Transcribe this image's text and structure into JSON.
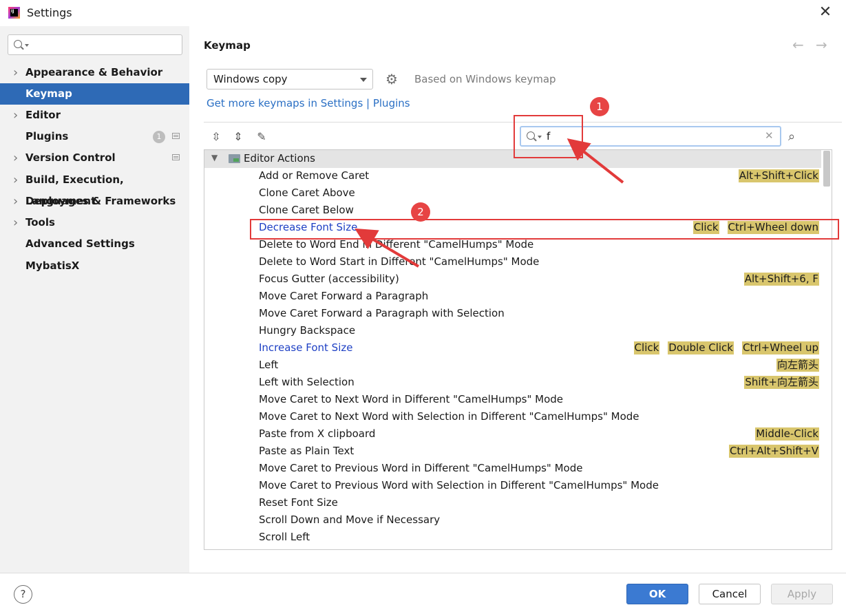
{
  "window": {
    "title": "Settings",
    "close_icon": "close-icon"
  },
  "sidebar": {
    "search_placeholder": "",
    "items": [
      {
        "label": "Appearance & Behavior",
        "expandable": true
      },
      {
        "label": "Keymap",
        "expandable": false,
        "selected": true
      },
      {
        "label": "Editor",
        "expandable": true
      },
      {
        "label": "Plugins",
        "expandable": false,
        "badge": "1"
      },
      {
        "label": "Version Control",
        "expandable": true
      },
      {
        "label": "Build, Execution, Deployment",
        "expandable": true
      },
      {
        "label": "Languages & Frameworks",
        "expandable": true
      },
      {
        "label": "Tools",
        "expandable": true
      },
      {
        "label": "Advanced Settings",
        "expandable": false
      },
      {
        "label": "MybatisX",
        "expandable": false
      }
    ]
  },
  "main": {
    "title": "Keymap",
    "keymap_select": "Windows copy",
    "based_on": "Based on Windows keymap",
    "get_more_link": "Get more keymaps in Settings | Plugins",
    "filter_value": "f",
    "group_label": "Editor Actions",
    "actions": [
      {
        "name": "Add or Remove Caret",
        "shortcuts": [
          "Alt+Shift+Click"
        ],
        "modified": false
      },
      {
        "name": "Clone Caret Above",
        "shortcuts": [],
        "modified": false
      },
      {
        "name": "Clone Caret Below",
        "shortcuts": [],
        "modified": false
      },
      {
        "name": "Decrease Font Size",
        "shortcuts": [
          "Click",
          "Ctrl+Wheel down"
        ],
        "modified": true
      },
      {
        "name": "Delete to Word End in Different \"CamelHumps\" Mode",
        "shortcuts": [],
        "modified": false
      },
      {
        "name": "Delete to Word Start in Different \"CamelHumps\" Mode",
        "shortcuts": [],
        "modified": false
      },
      {
        "name": "Focus Gutter (accessibility)",
        "shortcuts": [
          "Alt+Shift+6, F"
        ],
        "modified": false
      },
      {
        "name": "Move Caret Forward a Paragraph",
        "shortcuts": [],
        "modified": false
      },
      {
        "name": "Move Caret Forward a Paragraph with Selection",
        "shortcuts": [],
        "modified": false
      },
      {
        "name": "Hungry Backspace",
        "shortcuts": [],
        "modified": false
      },
      {
        "name": "Increase Font Size",
        "shortcuts": [
          "Click",
          "Double Click",
          "Ctrl+Wheel up"
        ],
        "modified": true
      },
      {
        "name": "Left",
        "shortcuts": [
          "向左箭头"
        ],
        "modified": false
      },
      {
        "name": "Left with Selection",
        "shortcuts": [
          "Shift+向左箭头"
        ],
        "modified": false
      },
      {
        "name": "Move Caret to Next Word in Different \"CamelHumps\" Mode",
        "shortcuts": [],
        "modified": false
      },
      {
        "name": "Move Caret to Next Word with Selection in Different \"CamelHumps\" Mode",
        "shortcuts": [],
        "modified": false
      },
      {
        "name": "Paste from X clipboard",
        "shortcuts": [
          "Middle-Click"
        ],
        "modified": false
      },
      {
        "name": "Paste as Plain Text",
        "shortcuts": [
          "Ctrl+Alt+Shift+V"
        ],
        "modified": false
      },
      {
        "name": "Move Caret to Previous Word in Different \"CamelHumps\" Mode",
        "shortcuts": [],
        "modified": false
      },
      {
        "name": "Move Caret to Previous Word with Selection in Different \"CamelHumps\" Mode",
        "shortcuts": [],
        "modified": false
      },
      {
        "name": "Reset Font Size",
        "shortcuts": [],
        "modified": false
      },
      {
        "name": "Scroll Down and Move if Necessary",
        "shortcuts": [],
        "modified": false
      },
      {
        "name": "Scroll Left",
        "shortcuts": [],
        "modified": false
      }
    ]
  },
  "annotations": {
    "marker_1": "1",
    "marker_2": "2",
    "color": "#e23a3a"
  },
  "footer": {
    "help": "?",
    "ok": "OK",
    "cancel": "Cancel",
    "apply": "Apply"
  },
  "colors": {
    "accent": "#2e6ab6",
    "shortcut_highlight": "#d9c66d",
    "modified_action": "#1d3fc4"
  }
}
